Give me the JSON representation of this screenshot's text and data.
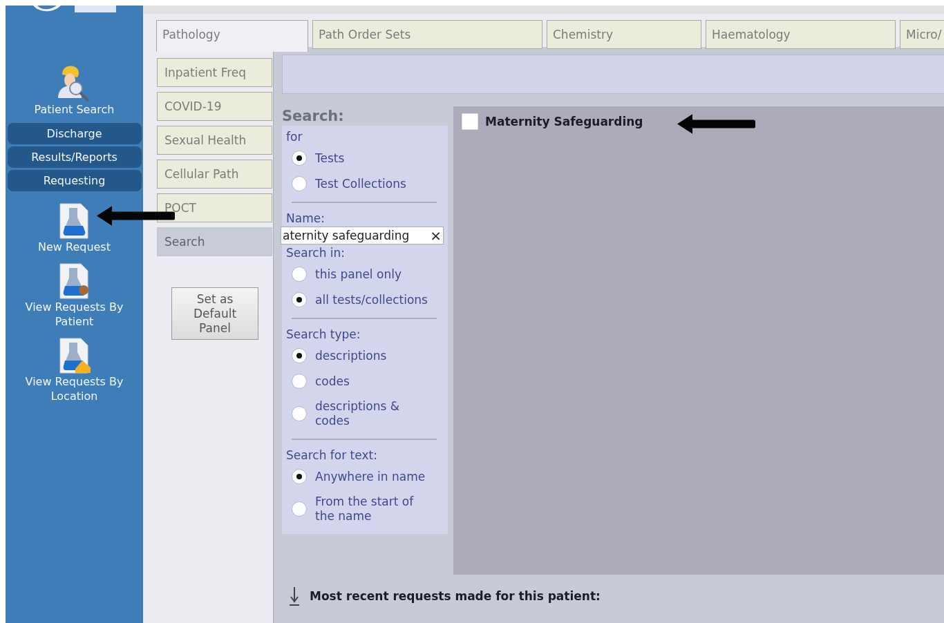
{
  "sidebar": {
    "patient_search": "Patient Search",
    "nav_buttons": [
      {
        "label": "Discharge"
      },
      {
        "label": "Results/Reports"
      },
      {
        "label": "Requesting"
      }
    ],
    "request_items": [
      {
        "label": "New Request",
        "kind": "new"
      },
      {
        "label": "View Requests By Patient",
        "kind": "patient"
      },
      {
        "label": "View Requests By Location",
        "kind": "location"
      }
    ]
  },
  "tabs": [
    {
      "label": "Pathology",
      "selected": true
    },
    {
      "label": "Path Order Sets",
      "selected": false
    },
    {
      "label": "Chemistry",
      "selected": false
    },
    {
      "label": "Haematology",
      "selected": false
    },
    {
      "label": "Micro/",
      "selected": false
    }
  ],
  "side_tabs": [
    {
      "label": "Inpatient Freq",
      "selected": false
    },
    {
      "label": "COVID-19",
      "selected": false
    },
    {
      "label": "Sexual Health",
      "selected": false
    },
    {
      "label": "Cellular Path",
      "selected": false
    },
    {
      "label": "POCT",
      "selected": false
    },
    {
      "label": "Search",
      "selected": true
    }
  ],
  "default_button": "Set as Default Panel",
  "search": {
    "title": "Search:",
    "sections": [
      {
        "kind": "radios",
        "label": "for",
        "options": [
          {
            "label": "Tests",
            "selected": true
          },
          {
            "label": "Test Collections",
            "selected": false
          }
        ]
      },
      {
        "kind": "field",
        "label": "Name:",
        "value": "aternity safeguarding",
        "clear": "×"
      },
      {
        "kind": "radios",
        "label": "Search in:",
        "options": [
          {
            "label": "this panel only",
            "selected": false
          },
          {
            "label": "all tests/collections",
            "selected": true
          }
        ]
      },
      {
        "kind": "radios",
        "label": "Search type:",
        "options": [
          {
            "label": "descriptions",
            "selected": true
          },
          {
            "label": "codes",
            "selected": false
          },
          {
            "label": "descriptions & codes",
            "selected": false
          }
        ]
      },
      {
        "kind": "radios",
        "label": "Search for text:",
        "options": [
          {
            "label": "Anywhere in name",
            "selected": true
          },
          {
            "label": "From the start of the name",
            "selected": false
          }
        ]
      }
    ]
  },
  "results": [
    {
      "label": "Maternity Safeguarding",
      "checked": false
    }
  ],
  "footer": {
    "label": "Most recent requests made for this patient:"
  }
}
